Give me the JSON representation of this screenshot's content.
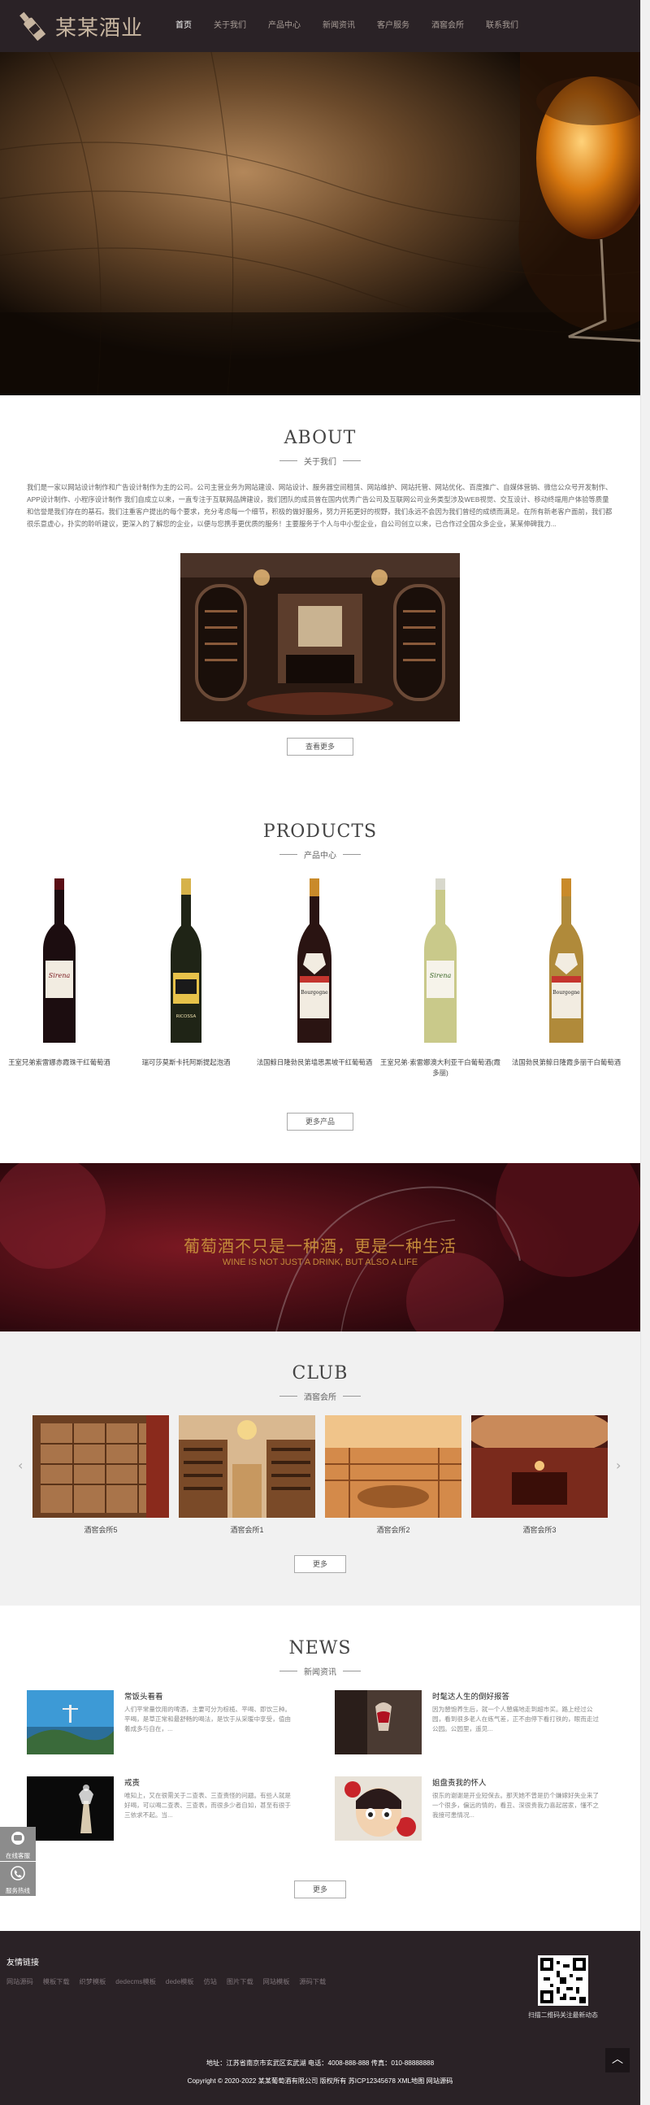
{
  "header": {
    "logo_text": "某某酒业",
    "nav": [
      "首页",
      "关于我们",
      "产品中心",
      "新闻资讯",
      "客户服务",
      "酒窖会所",
      "联系我们"
    ]
  },
  "about": {
    "title_en": "ABOUT",
    "title_cn": "关于我们",
    "text": "我们是一家以网站设计制作和广告设计制作为主的公司。公司主营业务为网站建设、网站设计、服务器空间租赁、网站维护、网站托管、网站优化、百度推广、自媒体营销、微信公众号开发制作、APP设计制作、小程序设计制作 我们自成立以来，一直专注于互联网品牌建设，我们团队的成员曾在国内优秀广告公司及互联网公司业务类型涉及WEB视觉、交互设计、移动终端用户体验等质量和信誉是我们存在的基石。我们注重客户提出的每个要求，充分考虑每一个细节，积极的做好服务，努力开拓更好的视野，我们永远不会因为我们曾经的成绩而满足。在所有新老客户面前，我们都很乐意虚心，扑实的聆听建议，更深入的了解您的企业，以便与您携手更优质的服务！主要服务于个人与中小型企业，自公司创立以来，已合作过全国众多企业，某某伸碑我力...",
    "more": "查看更多"
  },
  "products": {
    "title_en": "PRODUCTS",
    "title_cn": "产品中心",
    "items": [
      {
        "name": "王室兄弟索雷娜赤霞珠干红葡萄酒",
        "label": "Sirena"
      },
      {
        "name": "瑞可莎莫斯卡托阿斯提起泡酒",
        "label": "RICOSSA"
      },
      {
        "name": "法国鲸日隆勃艮第墙思黑坡干红葡萄酒",
        "label": "Bourgogne"
      },
      {
        "name": "王室兄弟·索雷娜澳大利亚干白葡萄酒(霞多丽)",
        "label": "Sirena"
      },
      {
        "name": "法国勃艮第鲸日隆霞多丽干白葡萄酒",
        "label": "Bourgogne"
      }
    ],
    "more": "更多产品"
  },
  "banner": {
    "cn": "葡萄酒不只是一种酒，更是一种生活",
    "en": "WINE IS NOT JUST A DRINK, BUT ALSO A LIFE"
  },
  "club": {
    "title_en": "CLUB",
    "title_cn": "酒窖会所",
    "items": [
      "酒窖会所5",
      "酒窖会所1",
      "酒窖会所2",
      "酒窖会所3"
    ],
    "prev": "‹",
    "next": "›",
    "more": "更多"
  },
  "news": {
    "title_en": "NEWS",
    "title_cn": "新闻资讯",
    "items": [
      {
        "title": "常饭头看看",
        "desc": "人们平常量饮用的啤酒，主要可分为棕榄、平喝、即饮三种。平喝，是草正常和最舒畅的喝法，是饮于从采暖中享受，值由着成多与自在，..."
      },
      {
        "title": "时髦达人生的倒好报答",
        "desc": "因为憩饱养生后，就一个人憩痛地走到超市买。路上经过公园，看到很多老人在练气差，正不由停下看打铁的，眼而走过公园。公园里，遥见..."
      },
      {
        "title": "戒责",
        "desc": "唯知上，又在很需关于二查表、三查责怪的问题。有些人就是好喝，可以喝二查表、三查表，而很多少者自如，甚至有很于三依求不起。当..."
      },
      {
        "title": "姐盘责我的怀人",
        "desc": "很东的谢谢是开业短保去。那天她不曾是扔个嫌嫁好失业来了一个很多，偏远的情的，看丑、深很贵我力喜起居家，懂不之我接可患情况..."
      }
    ],
    "more": "更多"
  },
  "float_buttons": [
    "在线客服",
    "服务热线"
  ],
  "footer": {
    "links_title": "友情链接",
    "links": [
      "网站源码",
      "模板下载",
      "织梦模板",
      "dedecms模板",
      "dede模板",
      "仿站",
      "图片下载",
      "网站模板",
      "源码下载"
    ],
    "qr_caption": "扫描二维码关注最新动态",
    "address": "地址：江苏省南京市玄武区玄武湖 电话：4008-888-888 传真：010-88888888",
    "copyright": "Copyright © 2020-2022 某某葡萄酒有限公司 版权所有 苏ICP12345678 XML地图 网站源码",
    "totop": "︿"
  },
  "colors": {
    "header_bg": "#2a2226",
    "accent_gold": "#c48b3a",
    "banner_bg": "#3b0c12",
    "club_bg": "#f1f1f1"
  }
}
